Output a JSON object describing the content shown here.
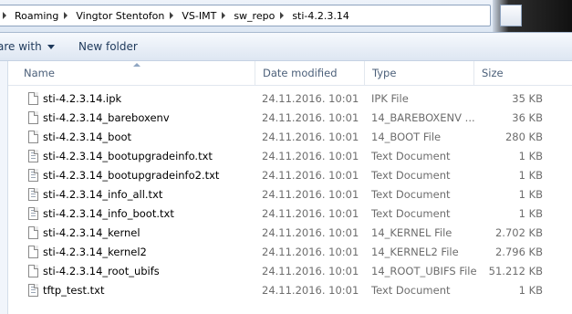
{
  "breadcrumb": [
    "Roaming",
    "Vingtor Stentofon",
    "VS-IMT",
    "sw_repo",
    "sti-4.2.3.14"
  ],
  "toolbar": {
    "share_label": "are with",
    "new_folder_label": "New folder"
  },
  "columns": {
    "name": "Name",
    "date": "Date modified",
    "type": "Type",
    "size": "Size"
  },
  "files": [
    {
      "name": "sti-4.2.3.14.ipk",
      "date": "24.11.2016. 10:01",
      "type": "IPK File",
      "size": "35 KB",
      "icon": "file-icon"
    },
    {
      "name": "sti-4.2.3.14_bareboxenv",
      "date": "24.11.2016. 10:01",
      "type": "14_BAREBOXENV ...",
      "size": "36 KB",
      "icon": "file-icon"
    },
    {
      "name": "sti-4.2.3.14_boot",
      "date": "24.11.2016. 10:01",
      "type": "14_BOOT File",
      "size": "280 KB",
      "icon": "file-icon"
    },
    {
      "name": "sti-4.2.3.14_bootupgradeinfo.txt",
      "date": "24.11.2016. 10:01",
      "type": "Text Document",
      "size": "1 KB",
      "icon": "text-file-icon"
    },
    {
      "name": "sti-4.2.3.14_bootupgradeinfo2.txt",
      "date": "24.11.2016. 10:01",
      "type": "Text Document",
      "size": "1 KB",
      "icon": "text-file-icon"
    },
    {
      "name": "sti-4.2.3.14_info_all.txt",
      "date": "24.11.2016. 10:01",
      "type": "Text Document",
      "size": "1 KB",
      "icon": "text-file-icon"
    },
    {
      "name": "sti-4.2.3.14_info_boot.txt",
      "date": "24.11.2016. 10:01",
      "type": "Text Document",
      "size": "1 KB",
      "icon": "text-file-icon"
    },
    {
      "name": "sti-4.2.3.14_kernel",
      "date": "24.11.2016. 10:01",
      "type": "14_KERNEL File",
      "size": "2.702 KB",
      "icon": "file-icon"
    },
    {
      "name": "sti-4.2.3.14_kernel2",
      "date": "24.11.2016. 10:01",
      "type": "14_KERNEL2 File",
      "size": "2.796 KB",
      "icon": "file-icon"
    },
    {
      "name": "sti-4.2.3.14_root_ubifs",
      "date": "24.11.2016. 10:01",
      "type": "14_ROOT_UBIFS File",
      "size": "51.212 KB",
      "icon": "file-icon"
    },
    {
      "name": "tftp_test.txt",
      "date": "24.11.2016. 10:01",
      "type": "Text Document",
      "size": "1 KB",
      "icon": "text-file-icon"
    }
  ]
}
